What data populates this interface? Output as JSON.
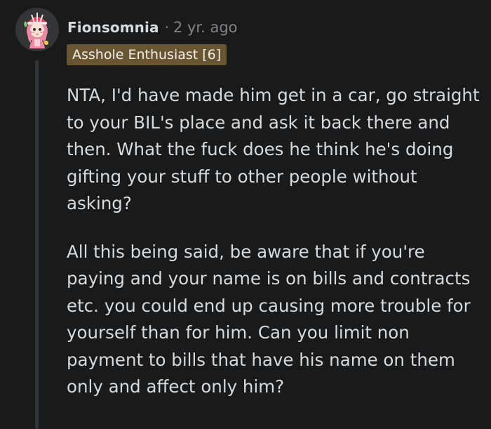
{
  "comment": {
    "username": "Fionsomnia",
    "separator": "·",
    "timestamp": "2 yr. ago",
    "flair": "Asshole Enthusiast [6]",
    "avatar_icon": "user-avatar-icon",
    "flair_color": "#6a5533",
    "paragraphs": [
      "NTA, I'd have made him get in a car, go straight to your BIL's place and ask it back there and then. What the fuck does he think he's doing gifting your stuff to other people without asking?",
      "All this being said, be aware that if you're paying and your name is on bills and contracts etc. you could end up causing more trouble for yourself than for him. Can you limit non payment to bills that have his name on them only and affect only him?"
    ]
  }
}
